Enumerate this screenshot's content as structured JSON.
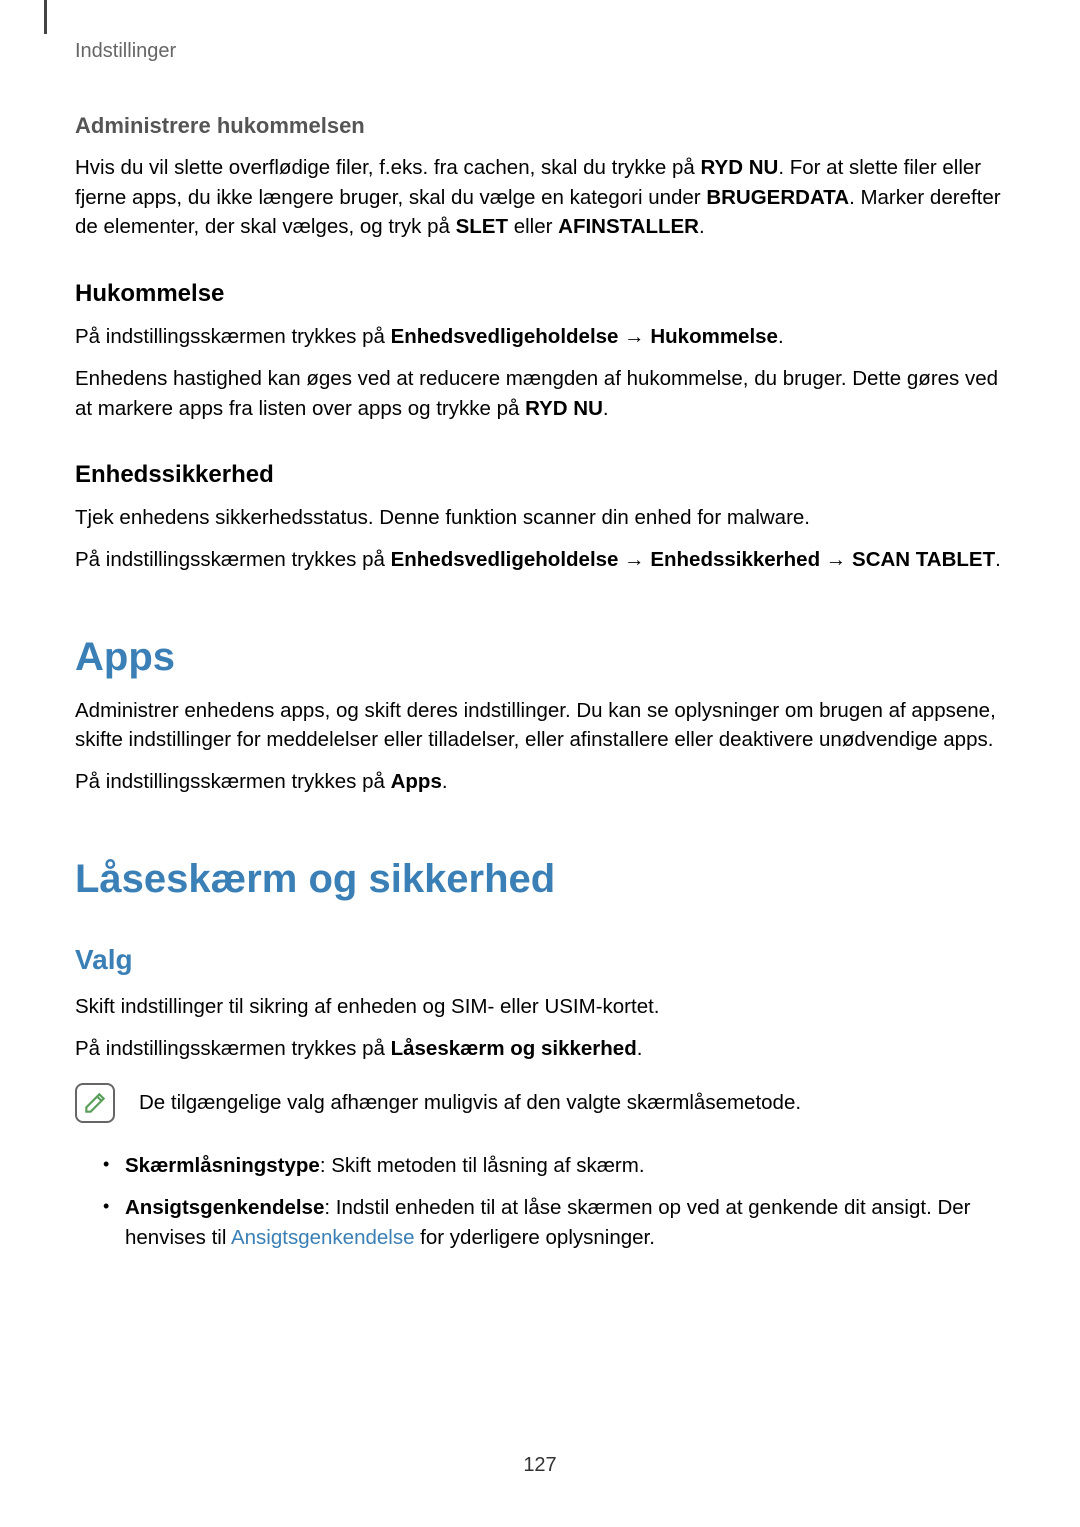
{
  "header": "Indstillinger",
  "section1": {
    "heading": "Administrere hukommelsen",
    "body_parts": [
      "Hvis du vil slette overflødige filer, f.eks. fra cachen, skal du trykke på ",
      "RYD NU",
      ". For at slette filer eller fjerne apps, du ikke længere bruger, skal du vælge en kategori under ",
      "BRUGERDATA",
      ". Marker derefter de elementer, der skal vælges, og tryk på ",
      "SLET",
      " eller ",
      "AFINSTALLER",
      "."
    ]
  },
  "section2": {
    "heading": "Hukommelse",
    "p1_parts": [
      "På indstillingsskærmen trykkes på ",
      "Enhedsvedligeholdelse",
      " → ",
      "Hukommelse",
      "."
    ],
    "p2_parts": [
      "Enhedens hastighed kan øges ved at reducere mængden af hukommelse, du bruger. Dette gøres ved at markere apps fra listen over apps og trykke på ",
      "RYD NU",
      "."
    ]
  },
  "section3": {
    "heading": "Enhedssikkerhed",
    "p1": "Tjek enhedens sikkerhedsstatus. Denne funktion scanner din enhed for malware.",
    "p2_parts": [
      "På indstillingsskærmen trykkes på ",
      "Enhedsvedligeholdelse",
      " → ",
      "Enhedssikkerhed",
      " → ",
      "SCAN TABLET",
      "."
    ]
  },
  "apps": {
    "heading": "Apps",
    "p1": "Administrer enhedens apps, og skift deres indstillinger. Du kan se oplysninger om brugen af appsene, skifte indstillinger for meddelelser eller tilladelser, eller afinstallere eller deaktivere unødvendige apps.",
    "p2_parts": [
      "På indstillingsskærmen trykkes på ",
      "Apps",
      "."
    ]
  },
  "lockscreen": {
    "heading": "Låseskærm og sikkerhed",
    "subheading": "Valg",
    "p1": "Skift indstillinger til sikring af enheden og SIM- eller USIM-kortet.",
    "p2_parts": [
      "På indstillingsskærmen trykkes på ",
      "Låseskærm og sikkerhed",
      "."
    ],
    "note": "De tilgængelige valg afhænger muligvis af den valgte skærmlåsemetode.",
    "bullets": [
      {
        "bold": "Skærmlåsningstype",
        "rest": ": Skift metoden til låsning af skærm."
      },
      {
        "bold": "Ansigtsgenkendelse",
        "rest_before_link": ": Indstil enheden til at låse skærmen op ved at genkende dit ansigt. Der henvises til ",
        "link": "Ansigtsgenkendelse",
        "rest_after_link": " for yderligere oplysninger."
      }
    ]
  },
  "page_number": "127"
}
